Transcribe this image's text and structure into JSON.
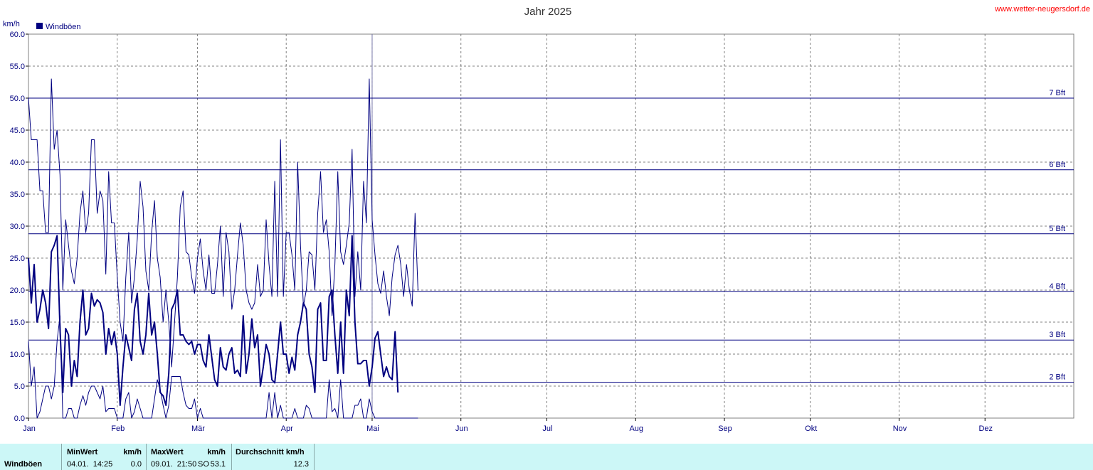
{
  "header": {
    "title": "Jahr 2025",
    "site": "www.wetter-neugersdorf.de",
    "unit": "km/h"
  },
  "legend": {
    "label": "Windböen",
    "color": "#000080"
  },
  "bft_lines": [
    {
      "label": "2 Bft",
      "value": 5.6
    },
    {
      "label": "3 Bft",
      "value": 12.2
    },
    {
      "label": "4 Bft",
      "value": 19.8
    },
    {
      "label": "5 Bft",
      "value": 28.8
    },
    {
      "label": "6 Bft",
      "value": 38.8
    },
    {
      "label": "7 Bft",
      "value": 50.0
    }
  ],
  "chart_data": {
    "type": "line",
    "title": "Jahr 2025",
    "ylabel": "km/h",
    "ylim": [
      0,
      60
    ],
    "yticks": [
      "0.0",
      "5.0",
      "10.0",
      "15.0",
      "20.0",
      "25.0",
      "30.0",
      "35.0",
      "40.0",
      "45.0",
      "50.0",
      "55.0",
      "60.0"
    ],
    "xlim": [
      0,
      365
    ],
    "months": [
      "Jan",
      "Feb",
      "Mär",
      "Apr",
      "Mai",
      "Jun",
      "Jul",
      "Aug",
      "Sep",
      "Okt",
      "Nov",
      "Dez"
    ],
    "grid": true,
    "legend_position": "top-left",
    "current_day": 120,
    "series": [
      {
        "name": "Windböen",
        "role": "max",
        "width": 1,
        "values": [
          50,
          43.5,
          43.5,
          43.5,
          35.5,
          35.5,
          29,
          29,
          53,
          42,
          45,
          38,
          20,
          31,
          27,
          23,
          21,
          25,
          32,
          35.5,
          29,
          32,
          43.5,
          43.5,
          32,
          35.5,
          34,
          22.5,
          38.5,
          30.5,
          30.5,
          22,
          15,
          12,
          22,
          29,
          18,
          22,
          28,
          37,
          33,
          23,
          20,
          29,
          34,
          25,
          22,
          15,
          20,
          15,
          8,
          15,
          22,
          33,
          35.5,
          26,
          25.5,
          22,
          19.5,
          25,
          28,
          23,
          20,
          25.5,
          19.5,
          19.5,
          24,
          30,
          19,
          29,
          26,
          17,
          20,
          25.5,
          30.5,
          27,
          20,
          18,
          17,
          18,
          24,
          19,
          20,
          31,
          24,
          19,
          37,
          19,
          43.5,
          19,
          29,
          29,
          25.5,
          20,
          40,
          27,
          17.5,
          20,
          26,
          25.5,
          20,
          32,
          38.5,
          29,
          31,
          26,
          16,
          24,
          38.5,
          26,
          24,
          27,
          30.5,
          42,
          19,
          26,
          20,
          37,
          30.5,
          53,
          31,
          25.5,
          21,
          19.5,
          23,
          19,
          16,
          22,
          25.5,
          27,
          24,
          19,
          24,
          20,
          17.5,
          32,
          20
        ]
      },
      {
        "name": "Windböen",
        "role": "mean",
        "width": 2,
        "values": [
          25,
          18,
          24,
          15,
          17,
          20,
          18,
          14,
          26,
          27,
          28.5,
          14,
          4,
          14,
          13,
          5,
          9,
          6.5,
          15,
          20,
          13,
          14,
          19.5,
          17.5,
          18.5,
          18,
          16.5,
          10,
          14,
          11.5,
          13.5,
          10,
          2,
          8,
          13,
          11,
          9,
          17,
          19.5,
          12,
          10,
          13,
          19.5,
          13,
          15,
          10,
          4,
          3.5,
          2,
          7,
          17,
          18,
          20,
          13,
          13,
          12,
          11.5,
          12,
          10,
          11.5,
          11.5,
          9,
          8,
          13,
          9.5,
          6,
          5,
          11,
          8,
          7.5,
          10,
          11,
          7,
          7.5,
          6.5,
          16,
          7,
          10,
          15.5,
          11,
          13,
          5,
          8,
          11.5,
          10,
          6,
          5.5,
          10,
          15,
          10,
          10,
          7,
          9.5,
          7.5,
          13,
          15,
          18,
          17,
          10,
          8,
          4,
          17,
          18,
          9,
          9,
          19,
          20,
          13,
          7,
          15,
          7,
          20,
          16,
          28.5,
          15,
          8.5,
          8.5,
          9,
          9,
          5,
          8,
          12.5,
          13.5,
          10,
          6.5,
          8,
          6.5,
          6,
          13.5,
          4
        ]
      },
      {
        "name": "Windböen",
        "role": "min",
        "width": 1,
        "values": [
          12,
          5,
          8,
          0,
          1,
          3,
          5,
          5,
          3,
          5,
          12,
          16,
          0,
          0,
          1.5,
          1.5,
          0,
          0,
          2,
          3.5,
          2,
          4,
          5,
          5,
          4,
          3,
          5,
          1,
          1.5,
          1.5,
          1.5,
          0,
          0,
          0,
          3,
          4,
          0,
          1,
          3,
          1.5,
          0,
          0,
          0,
          0,
          3,
          6,
          4.5,
          2,
          0,
          2,
          6.5,
          6.5,
          6.5,
          6.5,
          4,
          2,
          1.5,
          1.5,
          3,
          0,
          1.5,
          0,
          0,
          0,
          0,
          0,
          0,
          0,
          0,
          0,
          0,
          0,
          0,
          0,
          0,
          0,
          0,
          0,
          0,
          0,
          0,
          0,
          0,
          0,
          4,
          0,
          4,
          0,
          2,
          0,
          0,
          0,
          0,
          1.5,
          0,
          0,
          0,
          2,
          1.5,
          0,
          0,
          0,
          0,
          0,
          0,
          6,
          1,
          1.5,
          0,
          6,
          0,
          0,
          0,
          0,
          2,
          2,
          3,
          0,
          0,
          3,
          1,
          0,
          0,
          0,
          0,
          0,
          0,
          0,
          0,
          0,
          0,
          0,
          0,
          0,
          0,
          0,
          0
        ]
      }
    ]
  },
  "stats": {
    "row_label": "Windböen",
    "min_header": "MinWert",
    "min_unit": "km/h",
    "min_time": "04.01.  14:25",
    "min_value": "0.0",
    "max_header": "MaxWert",
    "max_unit": "km/h",
    "max_time": "09.01.  21:50",
    "max_dir": "SO",
    "max_value": "53.1",
    "avg_header": "Durchschnitt km/h",
    "avg_value": "12.3"
  }
}
